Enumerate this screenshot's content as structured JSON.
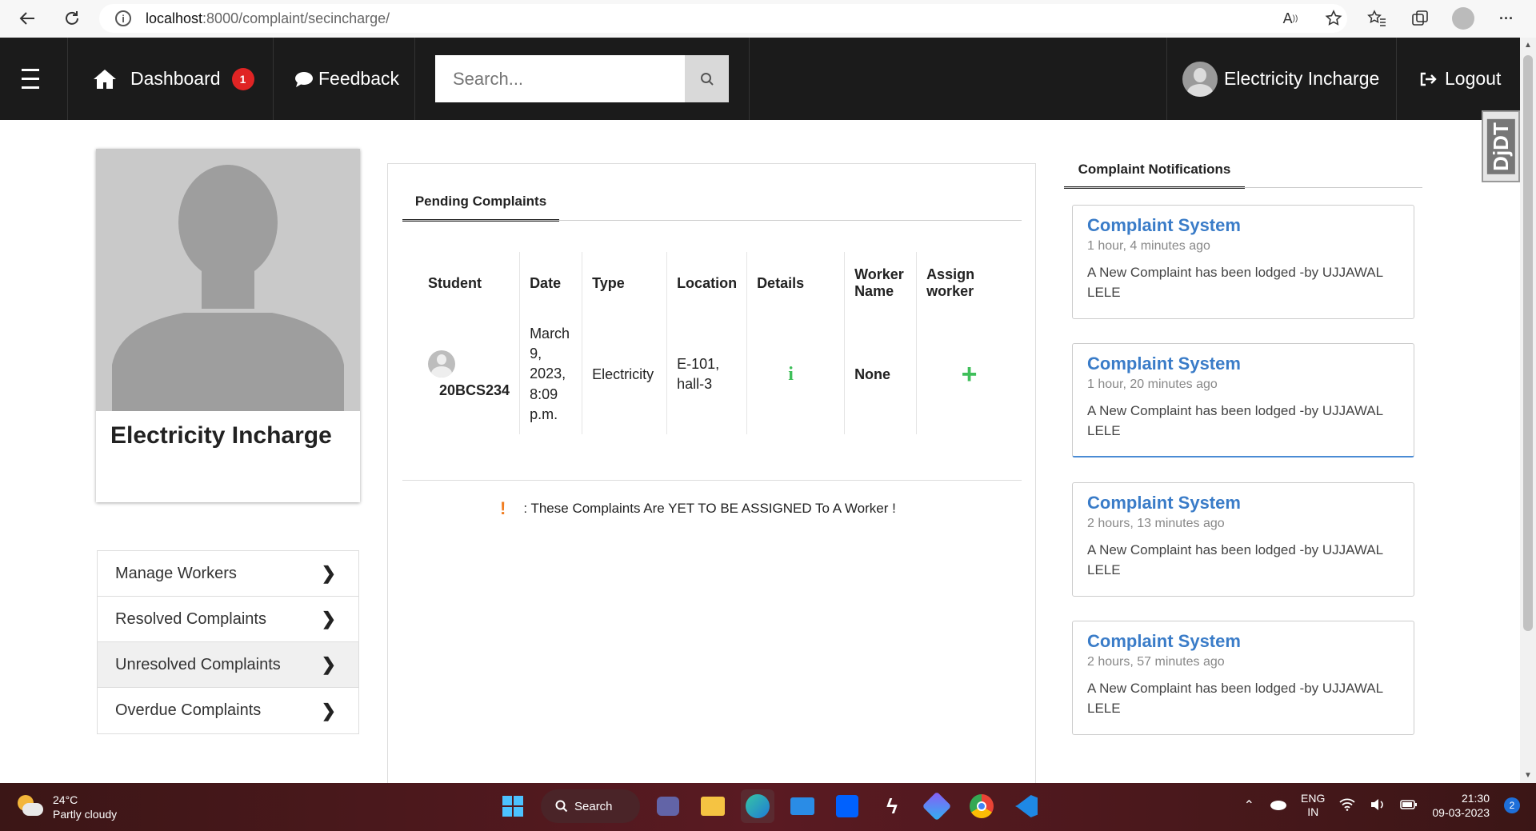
{
  "browser": {
    "url_host": "localhost",
    "url_path": ":8000/complaint/secincharge/"
  },
  "navbar": {
    "dashboard_label": "Dashboard",
    "dashboard_badge": "1",
    "feedback_label": "Feedback",
    "search_placeholder": "Search...",
    "user_label": "Electricity Incharge",
    "logout_label": "Logout"
  },
  "djdt_label": "DjDT",
  "profile": {
    "name": "Electricity Incharge"
  },
  "side_menu": {
    "items": [
      {
        "label": "Manage Workers"
      },
      {
        "label": "Resolved Complaints"
      },
      {
        "label": "Unresolved Complaints"
      },
      {
        "label": "Overdue Complaints"
      }
    ]
  },
  "pending": {
    "tab_label": "Pending Complaints",
    "headers": {
      "student": "Student",
      "date": "Date",
      "type": "Type",
      "location": "Location",
      "details": "Details",
      "worker_name": "Worker Name",
      "assign_worker": "Assign worker"
    },
    "rows": [
      {
        "student": "20BCS234",
        "date": "March 9, 2023, 8:09 p.m.",
        "type": "Electricity",
        "location": "E-101, hall-3",
        "worker_name": "None"
      }
    ],
    "note": ": These Complaints Are YET TO BE ASSIGNED To A Worker !"
  },
  "notifications": {
    "tab_label": "Complaint Notifications",
    "items": [
      {
        "title": "Complaint System",
        "time": "1 hour, 4 minutes ago",
        "message": "A New Complaint has been lodged -by UJJAWAL LELE"
      },
      {
        "title": "Complaint System",
        "time": "1 hour, 20 minutes ago",
        "message": "A New Complaint has been lodged -by UJJAWAL LELE"
      },
      {
        "title": "Complaint System",
        "time": "2 hours, 13 minutes ago",
        "message": "A New Complaint has been lodged -by UJJAWAL LELE"
      },
      {
        "title": "Complaint System",
        "time": "2 hours, 57 minutes ago",
        "message": "A New Complaint has been lodged -by UJJAWAL LELE"
      }
    ]
  },
  "taskbar": {
    "temperature": "24°C",
    "weather": "Partly cloudy",
    "search_label": "Search",
    "lang_top": "ENG",
    "lang_bottom": "IN",
    "time": "21:30",
    "date": "09-03-2023",
    "notification_count": "2"
  },
  "colors": {
    "navbar_bg": "#1b1b1b",
    "badge_red": "#e02424",
    "link_blue": "#3a7cc8",
    "icon_green": "#3fbf5a",
    "warning_orange": "#f07c20"
  }
}
